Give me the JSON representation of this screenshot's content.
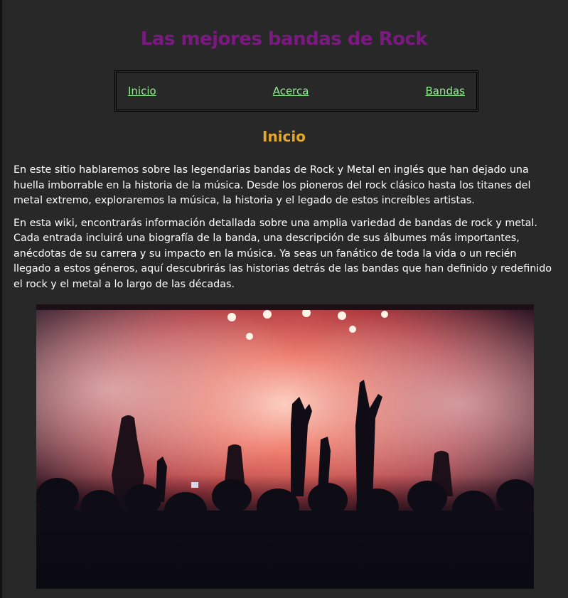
{
  "header": {
    "title": "Las mejores bandas de Rock"
  },
  "nav": {
    "items": [
      {
        "label": "Inicio"
      },
      {
        "label": "Acerca"
      },
      {
        "label": "Bandas"
      }
    ]
  },
  "main": {
    "section_title": "Inicio",
    "paragraphs": [
      "En este sitio hablaremos sobre las legendarias bandas de Rock y Metal en inglés que han dejado una huella imborrable en la historia de la música. Desde los pioneros del rock clásico hasta los titanes del metal extremo, exploraremos la música, la historia y el legado de estos increíbles artistas.",
      "En esta wiki, encontrarás información detallada sobre una amplia variedad de bandas de rock y metal. Cada entrada incluirá una biografía de la banda, una descripción de sus álbumes más importantes, anécdotas de su carrera y su impacto en la música. Ya seas un fanático de toda la vida o un recién llegado a estos géneros, aquí descubrirás las historias detrás de las bandas que han definido y redefinido el rock y el metal a lo largo de las décadas."
    ]
  },
  "colors": {
    "background": "#282828",
    "title": "#7a1a80",
    "nav_link": "#90ee90",
    "section_title": "#e4a82a",
    "text": "#ffffff"
  }
}
